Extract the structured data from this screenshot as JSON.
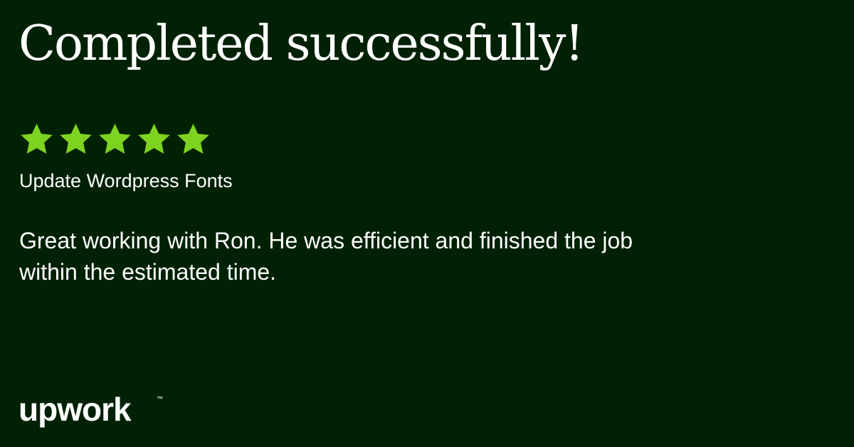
{
  "headline": "Completed successfully!",
  "rating": {
    "value": 5,
    "max": 5,
    "star_icon": "star-icon",
    "star_color": "#7ED321"
  },
  "job": {
    "title": "Update Wordpress Fonts"
  },
  "review": {
    "text": "Great working with Ron. He was efficient and finished the job within the estimated time."
  },
  "brand": {
    "logo_text": "upwork",
    "trademark": "™"
  },
  "colors": {
    "background": "#012104",
    "text": "#FFFFFF"
  }
}
